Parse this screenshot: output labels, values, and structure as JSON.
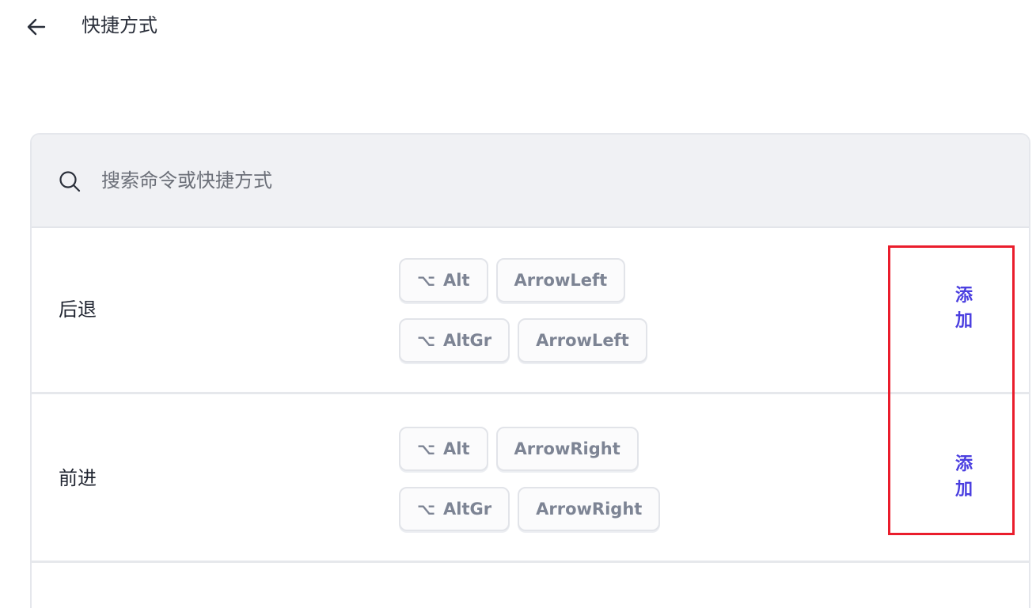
{
  "header": {
    "title": "快捷方式"
  },
  "search": {
    "placeholder": "搜索命令或快捷方式",
    "value": ""
  },
  "shortcuts": [
    {
      "label": "后退",
      "combos": [
        {
          "modifier_glyph": "⌥",
          "modifier": "Alt",
          "key": "ArrowLeft"
        },
        {
          "modifier_glyph": "⌥",
          "modifier": "AltGr",
          "key": "ArrowLeft"
        }
      ],
      "add_label": "添加"
    },
    {
      "label": "前进",
      "combos": [
        {
          "modifier_glyph": "⌥",
          "modifier": "Alt",
          "key": "ArrowRight"
        },
        {
          "modifier_glyph": "⌥",
          "modifier": "AltGr",
          "key": "ArrowRight"
        }
      ],
      "add_label": "添加"
    }
  ],
  "colors": {
    "accent": "#4b3fe0",
    "highlight": "#ea1d2c",
    "key_text": "#7d8494",
    "search_bg": "#f0f1f4"
  },
  "icons": {
    "back": "arrow-left-icon",
    "search": "search-icon"
  }
}
